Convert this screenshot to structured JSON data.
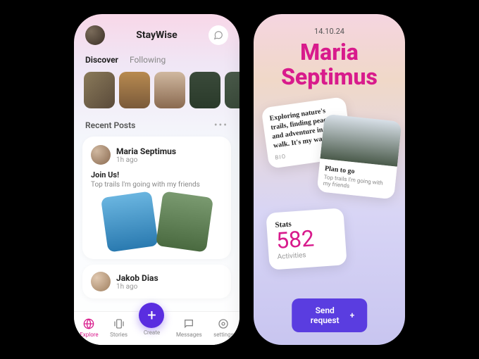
{
  "left": {
    "appTitle": "StayWise",
    "tabs": {
      "discover": "Discover",
      "following": "Following"
    },
    "stories": [
      {
        "bg": "linear-gradient(135deg,#8a7a5a,#5a4a3a)"
      },
      {
        "bg": "linear-gradient(180deg,#b88a50,#7a5a3a)"
      },
      {
        "bg": "linear-gradient(180deg,#d0b8a0,#8a6a50)"
      },
      {
        "bg": "linear-gradient(180deg,#3a4a3a,#2a3a2a)"
      },
      {
        "bg": "linear-gradient(180deg,#4a5a4a,#3a4a3a)"
      }
    ],
    "sectionTitle": "Recent Posts",
    "posts": [
      {
        "author": "Maria Septimus",
        "time": "1h ago",
        "title": "Join Us!",
        "sub": "Top trails I'm going with my friends",
        "avatar": "radial-gradient(circle at 30% 30%,#d0b8a0,#8a6a50)",
        "imgs": [
          "linear-gradient(180deg,#6ab5e0,#2a7ab0)",
          "linear-gradient(180deg,#7a9a70,#4a6a40)"
        ]
      },
      {
        "author": "Jakob Dias",
        "time": "1h ago",
        "avatar": "radial-gradient(circle at 30% 30%,#e0c8b0,#a08060)"
      }
    ],
    "nav": {
      "explore": "Explore",
      "stories": "Stories",
      "create": "Create",
      "messages": "Messages",
      "settings": "settings"
    }
  },
  "right": {
    "date": "14.10.24",
    "nameFirst": "Maria",
    "nameLast": "Septimus",
    "bio": {
      "text": "Exploring nature's trails, finding peace and adventure in every walk. It's my way",
      "label": "BIO"
    },
    "plan": {
      "title": "Plan to go",
      "sub": "Top trails I'm going with my friends"
    },
    "stats": {
      "label": "Stats",
      "value": "582",
      "sub": "Activities"
    },
    "button": "Send request"
  }
}
